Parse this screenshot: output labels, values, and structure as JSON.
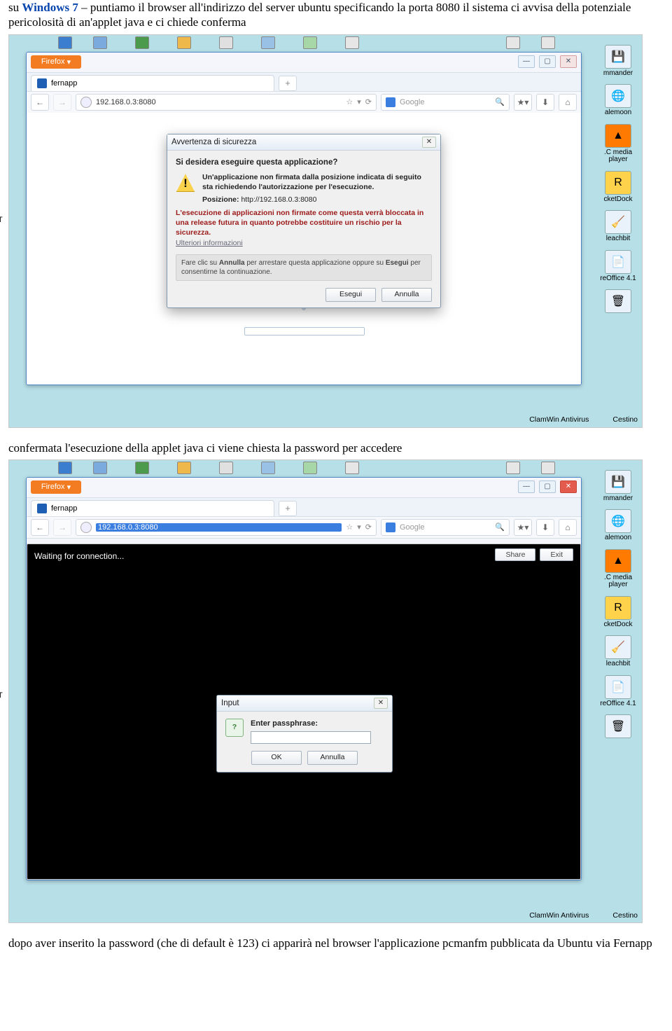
{
  "para1_prefix": "su ",
  "para1_win7": "Windows 7",
  "para1_rest": " – puntiamo il browser all'indirizzo del server ubuntu specificando la porta 8080 il sistema ci avvisa della potenziale pericolosità di an'applet java e ci chiede conferma",
  "para2": "confermata l'esecuzione della applet java ci viene chiesta la password per accedere",
  "para3": "dopo aver inserito la password (che di default è 123) ci apparirà nel browser l'applicazione pcmanfm pubblicata da Ubuntu via Fernapp",
  "ff": {
    "menu": "Firefox",
    "tab_label": "fernapp",
    "url": "192.168.0.3:8080",
    "search_ph": "Google"
  },
  "sideicons": {
    "mmcmd": "mmander",
    "alemoon": "alemoon",
    "vlc": ".C media player",
    "rocket": "cketDock",
    "bleach": "leachbit",
    "libre": "reOffice 4.1"
  },
  "bottom": {
    "clam": "ClamWin Antivirus",
    "cestino": "Cestino"
  },
  "jdlg": {
    "title": "Avvertenza di sicurezza",
    "q": "Si desidera eseguire questa applicazione?",
    "line1": "Un'applicazione non firmata dalla posizione indicata di seguito sta richiedendo l'autorizzazione per l'esecuzione.",
    "pos_label": "Posizione:",
    "pos_val": "http://192.168.0.3:8080",
    "warn": "L'esecuzione di applicazioni non firmate come questa verrà bloccata in una release futura in quanto potrebbe costituire un rischio per la sicurezza.",
    "more": "Ulteriori informazioni",
    "hint_a": "Fare clic su ",
    "hint_b": "Annulla",
    "hint_c": " per arrestare questa applicazione oppure su ",
    "hint_d": "Esegui",
    "hint_e": " per consentirne la continuazione.",
    "btn_run": "Esegui",
    "btn_cancel": "Annulla"
  },
  "shot2": {
    "waiting": "Waiting for connection...",
    "share": "Share",
    "exit": "Exit",
    "dlg_title": "Input",
    "pass_label": "Enter passphrase:",
    "ok": "OK",
    "cancel": "Annulla"
  }
}
